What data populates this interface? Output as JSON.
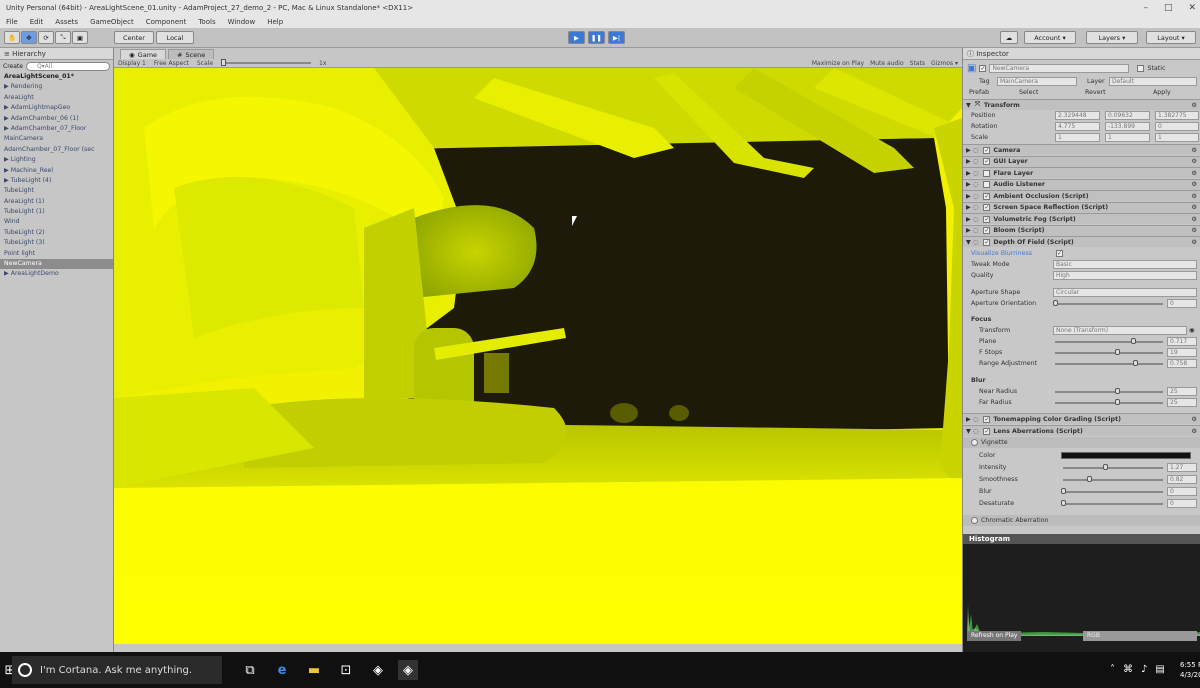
{
  "window": {
    "title": "Unity Personal (64bit) - AreaLightScene_01.unity - AdamProject_27_demo_2 - PC, Mac & Linux Standalone* <DX11>"
  },
  "menu": [
    "File",
    "Edit",
    "Assets",
    "GameObject",
    "Component",
    "Tools",
    "Window",
    "Help"
  ],
  "toolbar": {
    "pivot": "Center",
    "space": "Local",
    "account": "Account",
    "layers": "Layers",
    "layout": "Layout"
  },
  "hierarchy": {
    "tab": "Hierarchy",
    "create": "Create",
    "search_placeholder": "Q▾All",
    "items": [
      {
        "label": "AreaLightScene_01*",
        "root": true
      },
      {
        "label": "▶ Rendering"
      },
      {
        "label": "  AreaLight"
      },
      {
        "label": "▶ AdamLightmapGeo"
      },
      {
        "label": "▶ AdamChamber_06 (1)"
      },
      {
        "label": "▶ AdamChamber_07_Floor"
      },
      {
        "label": "  MainCamera"
      },
      {
        "label": "  AdamChamber_07_Floor (sec"
      },
      {
        "label": "▶ Lighting"
      },
      {
        "label": "▶ Machine_Reel"
      },
      {
        "label": "▶ TubeLight (4)"
      },
      {
        "label": "  TubeLight"
      },
      {
        "label": "  AreaLight (1)"
      },
      {
        "label": "  TubeLight (1)"
      },
      {
        "label": "  Wind"
      },
      {
        "label": "  TubeLight (2)"
      },
      {
        "label": "  TubeLight (3)"
      },
      {
        "label": "  Point light"
      },
      {
        "label": "  NewCamera",
        "selected": true
      },
      {
        "label": "▶ AreaLightDemo"
      }
    ]
  },
  "game": {
    "tabs": [
      "Game",
      "Scene"
    ],
    "display": "Display 1",
    "aspect": "Free Aspect",
    "scale_label": "Scale",
    "scale_value": "1x",
    "maximize": "Maximize on Play",
    "mute": "Mute audio",
    "stats": "Stats",
    "gizmos": "Gizmos ▾"
  },
  "inspector": {
    "tab": "Inspector",
    "object_name": "NewCamera",
    "static": "Static",
    "tag_label": "Tag",
    "tag": "MainCamera",
    "layer_label": "Layer",
    "layer": "Default",
    "prefab_label": "Prefab",
    "prefab_select": "Select",
    "prefab_revert": "Revert",
    "prefab_apply": "Apply",
    "transform": "Transform",
    "position_label": "Position",
    "rotation_label": "Rotation",
    "scale_label": "Scale",
    "pos": [
      "2.329448",
      "0.09632",
      "1.382775"
    ],
    "rot": [
      "4.775",
      "-133.899",
      "0"
    ],
    "scl": [
      "1",
      "1",
      "1"
    ],
    "components": [
      {
        "label": "Camera",
        "checked": true
      },
      {
        "label": "GUI Layer",
        "checked": true
      },
      {
        "label": "Flare Layer",
        "checked": false
      },
      {
        "label": "Audio Listener",
        "checked": false
      },
      {
        "label": "Ambient Occlusion (Script)",
        "checked": true
      },
      {
        "label": "Screen Space Reflection (Script)",
        "checked": true
      },
      {
        "label": "Volumetric Fog (Script)",
        "checked": true
      },
      {
        "label": "Bloom (Script)",
        "checked": true
      },
      {
        "label": "Depth Of Field (Script)",
        "checked": true
      }
    ],
    "dof": {
      "visualize": "Visualize Blurriness",
      "tweak_mode": "Tweak Mode",
      "tweak_mode_value": "Basic",
      "quality": "Quality",
      "quality_value": "High",
      "aperture_shape": "Aperture Shape",
      "aperture_shape_value": "Circular",
      "aperture_orientation": "Aperture Orientation",
      "aperture_orientation_value": "0",
      "focus": "Focus",
      "transform": "Transform",
      "transform_value": "None (Transform)",
      "plane": "Plane",
      "plane_value": "0.717",
      "fstops": "F Stops",
      "fstops_value": "19",
      "range_adjustment": "Range Adjustment",
      "range_adjustment_value": "0.758",
      "blur": "Blur",
      "near_radius": "Near Radius",
      "near_radius_value": "25",
      "far_radius": "Far Radius",
      "far_radius_value": "25"
    },
    "tonemapping": "Tonemapping Color Grading (Script)",
    "lens": "Lens Aberrations (Script)",
    "vignette": "Vignette",
    "v_color": "Color",
    "v_intensity": "Intensity",
    "v_intensity_value": "1.27",
    "v_smoothness": "Smoothness",
    "v_smoothness_value": "0.82",
    "v_blur": "Blur",
    "v_blur_value": "0",
    "v_desaturate": "Desaturate",
    "v_desaturate_value": "0",
    "chromatic": "Chromatic Aberration"
  },
  "histogram": {
    "title": "Histogram",
    "refresh": "Refresh on Play",
    "mode": "RGB"
  },
  "taskbar": {
    "cortana": "I'm Cortana. Ask me anything.",
    "time": "6:55 P",
    "date": "4/3/20"
  },
  "colors": {
    "viewport_yellow": "#f2f200",
    "dark_void": "#1d1a0a",
    "selection_blue": "#3c78d8"
  }
}
